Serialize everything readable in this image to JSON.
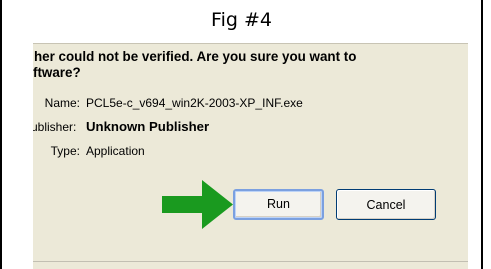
{
  "caption": "Fig #4",
  "dialog": {
    "warning_line1": "her could not be verified.  Are you sure you want to",
    "warning_line2": "ftware?",
    "fields": {
      "name_label": "Name:",
      "name_value": "PCL5e-c_v694_win2K-2003-XP_INF.exe",
      "publisher_label": "ublisher:",
      "publisher_value": "Unknown Publisher",
      "type_label": "Type:",
      "type_value": "Application"
    },
    "buttons": {
      "run_label": "Run",
      "cancel_label": "Cancel"
    },
    "arrow_icon": "green-right-arrow",
    "colors": {
      "dialog_background": "#ece9d8",
      "arrow_green": "#1a9a1f",
      "button_border": "#003c74",
      "focus_border": "#7ba0e0"
    }
  }
}
